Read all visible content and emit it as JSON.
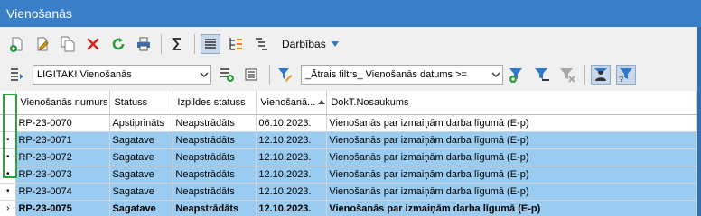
{
  "window": {
    "title": "Vienošanās"
  },
  "toolbar": {
    "icons": [
      "new-doc-icon",
      "edit-doc-icon",
      "copy-doc-icon",
      "delete-icon",
      "refresh-icon",
      "print-icon",
      "sum-icon",
      "list-view-icon",
      "tree-view-icon",
      "indent-icon"
    ],
    "actions_label": "Darbības"
  },
  "filter_bar": {
    "view_select": "LIGITAKI Vienošanās",
    "quick_filter": "_Ātrais filtrs_ Vienošanās datums >="
  },
  "colors": {
    "title_bar": "#3a7ec7",
    "selection": "#99ccf0",
    "highlight_border": "#27a43c",
    "accent": "#2f79c8"
  },
  "grid": {
    "columns": [
      "Vienošanās numurs",
      "Statuss",
      "Izpildes statuss",
      "Vienošanā...",
      "DokT.Nosaukums"
    ],
    "sorted_column_index": 3,
    "rows": [
      {
        "marker": "",
        "cells": [
          "RP-23-0070",
          "Apstiprināts",
          "Neapstrādāts",
          "06.10.2023.",
          "Vienošanās par izmaiņām darba līgumā (E-p)"
        ]
      },
      {
        "marker": "•",
        "cells": [
          "RP-23-0071",
          "Sagatave",
          "Neapstrādāts",
          "12.10.2023.",
          "Vienošanās par izmaiņām darba līgumā (E-p)"
        ]
      },
      {
        "marker": "•",
        "cells": [
          "RP-23-0072",
          "Sagatave",
          "Neapstrādāts",
          "12.10.2023.",
          "Vienošanās par izmaiņām darba līgumā (E-p)"
        ]
      },
      {
        "marker": "•",
        "cells": [
          "RP-23-0073",
          "Sagatave",
          "Neapstrādāts",
          "12.10.2023.",
          "Vienošanās par izmaiņām darba līgumā (E-p)"
        ]
      },
      {
        "marker": "•",
        "cells": [
          "RP-23-0074",
          "Sagatave",
          "Neapstrādāts",
          "12.10.2023.",
          "Vienošanās par izmaiņām darba līgumā (E-p)"
        ]
      },
      {
        "marker": "›",
        "cells": [
          "RP-23-0075",
          "Sagatave",
          "Neapstrādāts",
          "12.10.2023.",
          "Vienošanās par izmaiņām darba līgumā (E-p)"
        ]
      }
    ]
  }
}
